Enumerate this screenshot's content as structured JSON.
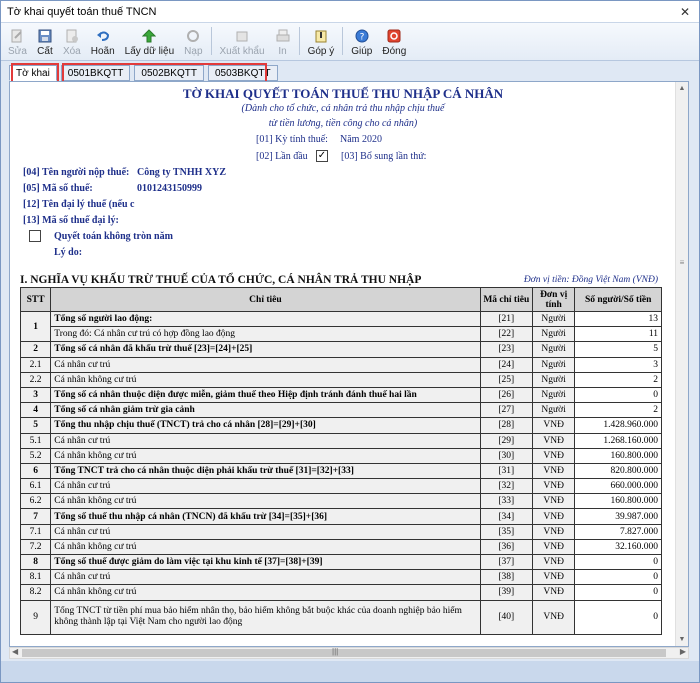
{
  "window": {
    "title": "Tờ khai quyết toán thuế TNCN"
  },
  "toolbar": [
    {
      "label": "Sửa",
      "icon": "edit-icon",
      "enabled": false
    },
    {
      "label": "Cất",
      "icon": "save-icon",
      "enabled": true
    },
    {
      "label": "Xóa",
      "icon": "delete-icon",
      "enabled": false
    },
    {
      "label": "Hoãn",
      "icon": "undo-icon",
      "enabled": true
    },
    {
      "label": "Lấy dữ liệu",
      "icon": "get-data-icon",
      "enabled": true
    },
    {
      "label": "Nạp",
      "icon": "load-icon",
      "enabled": false
    },
    {
      "label": "Xuất khẩu",
      "icon": "export-icon",
      "enabled": false
    },
    {
      "label": "In",
      "icon": "print-icon",
      "enabled": false
    },
    {
      "label": "Góp ý",
      "icon": "feedback-icon",
      "enabled": true
    },
    {
      "label": "Giúp",
      "icon": "help-icon",
      "enabled": true
    },
    {
      "label": "Đóng",
      "icon": "close-icon",
      "enabled": true
    }
  ],
  "tabs": [
    "Tờ khai",
    "0501BKQTT",
    "0502BKQTT",
    "0503BKQTT"
  ],
  "form": {
    "title": "TỜ KHAI QUYẾT TOÁN THUẾ THU NHẬP CÁ NHÂN",
    "subtitle1": "(Dành cho tổ chức, cá nhân trả thu nhập chịu thuế",
    "subtitle2": "từ tiền lương, tiền công cho cá nhân)",
    "period_label": "[01] Kỳ tính thuế:",
    "period_value": "Năm 2020",
    "first_label": "[02] Lần đầu",
    "first_checked": true,
    "supplement_label": "[03] Bổ sung lần thứ:",
    "taxpayer_label": "[04] Tên người nộp thuế:",
    "taxpayer_value": "Công ty TNHH XYZ",
    "taxcode_label": "[05] Mã số thuế:",
    "taxcode_value": "0101243150999",
    "agent_label": "[12] Tên đại lý thuế (nếu c",
    "agent_code_label": "[13] Mã số thuế đại lý:",
    "incomplete_year_label": "Quyết toán không tròn năm",
    "reason_label": "Lý do:",
    "section_title": "I. NGHĨA VỤ KHẤU TRỪ THUẾ CỦA TỔ CHỨC, CÁ NHÂN TRẢ THU NHẬP",
    "unit_note": "Đơn vị tiền: Đồng Việt Nam (VNĐ)"
  },
  "table": {
    "headers": [
      "STT",
      "Chỉ tiêu",
      "Mã chỉ tiêu",
      "Đơn vị tính",
      "Số người/Số tiền"
    ],
    "rows": [
      {
        "stt": "1",
        "desc": "Tổng số người lao động:",
        "code": "[21]",
        "unit": "Người",
        "value": "13",
        "bold": true,
        "rowspan_stt": 2
      },
      {
        "stt": "",
        "desc": "Trong đó: Cá nhân cư trú có hợp đồng lao động",
        "code": "[22]",
        "unit": "Người",
        "value": "11",
        "bold": false
      },
      {
        "stt": "2",
        "desc": "Tổng số cá nhân đã khấu trừ thuế [23]=[24]+[25]",
        "code": "[23]",
        "unit": "Người",
        "value": "5",
        "bold": true
      },
      {
        "stt": "2.1",
        "desc": "Cá nhân cư trú",
        "code": "[24]",
        "unit": "Người",
        "value": "3",
        "bold": false
      },
      {
        "stt": "2.2",
        "desc": "Cá nhân không cư trú",
        "code": "[25]",
        "unit": "Người",
        "value": "2",
        "bold": false
      },
      {
        "stt": "3",
        "desc": "Tổng số cá nhân thuộc diện được miễn, giảm thuế theo Hiệp định tránh đánh thuế hai lần",
        "code": "[26]",
        "unit": "Người",
        "value": "0",
        "bold": true
      },
      {
        "stt": "4",
        "desc": "Tổng số cá nhân giảm trừ gia cảnh",
        "code": "[27]",
        "unit": "Người",
        "value": "2",
        "bold": true
      },
      {
        "stt": "5",
        "desc": "Tổng thu nhập chịu thuế (TNCT) trả cho cá nhân [28]=[29]+[30]",
        "code": "[28]",
        "unit": "VNĐ",
        "value": "1.428.960.000",
        "bold": true
      },
      {
        "stt": "5.1",
        "desc": "Cá nhân cư trú",
        "code": "[29]",
        "unit": "VNĐ",
        "value": "1.268.160.000",
        "bold": false
      },
      {
        "stt": "5.2",
        "desc": "Cá nhân không cư trú",
        "code": "[30]",
        "unit": "VNĐ",
        "value": "160.800.000",
        "bold": false
      },
      {
        "stt": "6",
        "desc": "Tổng TNCT trả cho cá nhân thuộc diện phải khấu trừ thuế [31]=[32]+[33]",
        "code": "[31]",
        "unit": "VNĐ",
        "value": "820.800.000",
        "bold": true
      },
      {
        "stt": "6.1",
        "desc": "Cá nhân cư trú",
        "code": "[32]",
        "unit": "VNĐ",
        "value": "660.000.000",
        "bold": false
      },
      {
        "stt": "6.2",
        "desc": "Cá nhân không cư trú",
        "code": "[33]",
        "unit": "VNĐ",
        "value": "160.800.000",
        "bold": false
      },
      {
        "stt": "7",
        "desc": "Tổng số thuế thu nhập cá nhân (TNCN) đã khấu trừ [34]=[35]+[36]",
        "code": "[34]",
        "unit": "VNĐ",
        "value": "39.987.000",
        "bold": true
      },
      {
        "stt": "7.1",
        "desc": "Cá nhân cư trú",
        "code": "[35]",
        "unit": "VNĐ",
        "value": "7.827.000",
        "bold": false
      },
      {
        "stt": "7.2",
        "desc": "Cá nhân không cư trú",
        "code": "[36]",
        "unit": "VNĐ",
        "value": "32.160.000",
        "bold": false
      },
      {
        "stt": "8",
        "desc": "Tổng số thuế được giảm do làm việc tại khu kinh tế [37]=[38]+[39]",
        "code": "[37]",
        "unit": "VNĐ",
        "value": "0",
        "bold": true
      },
      {
        "stt": "8.1",
        "desc": "Cá nhân cư trú",
        "code": "[38]",
        "unit": "VNĐ",
        "value": "0",
        "bold": false
      },
      {
        "stt": "8.2",
        "desc": "Cá nhân không cư trú",
        "code": "[39]",
        "unit": "VNĐ",
        "value": "0",
        "bold": false
      },
      {
        "stt": "9",
        "desc": "Tổng TNCT từ tiền phí mua bảo hiểm nhân thọ, bảo hiểm không bắt buộc khác của doanh nghiệp bảo hiểm không thành lập tại Việt Nam cho người lao động",
        "code": "[40]",
        "unit": "VNĐ",
        "value": "0",
        "bold": false,
        "wrap": true
      }
    ]
  },
  "colors": {
    "highlight": "#e23a3a",
    "label_navy": "#1e2f8a"
  }
}
